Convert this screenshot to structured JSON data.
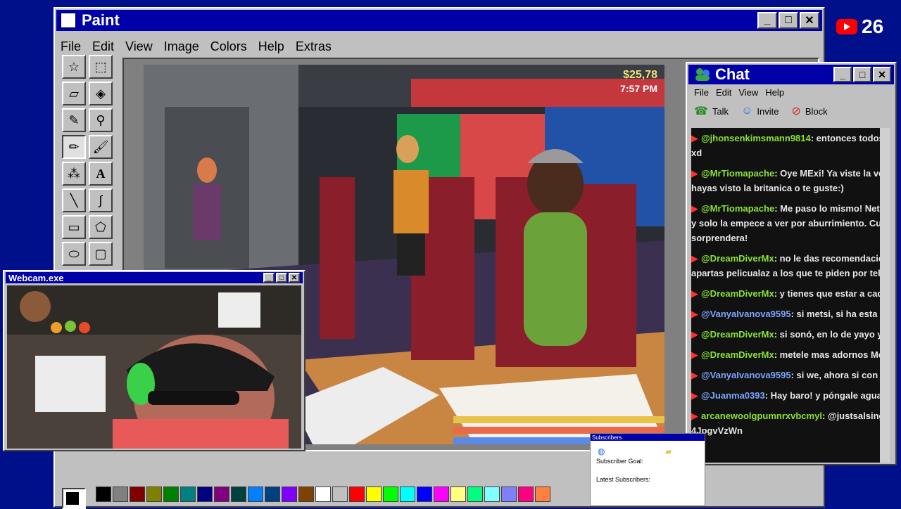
{
  "paint": {
    "title": "Paint",
    "menu": [
      "File",
      "Edit",
      "View",
      "Image",
      "Colors",
      "Help",
      "Extras"
    ],
    "tools": [
      "free-select",
      "rect-select",
      "eraser",
      "fill",
      "picker",
      "magnifier",
      "pencil",
      "brush",
      "airbrush",
      "text",
      "line",
      "curve",
      "rectangle",
      "polygon",
      "ellipse",
      "rounded-rect"
    ],
    "palette": [
      "#000000",
      "#808080",
      "#800000",
      "#808000",
      "#008000",
      "#008080",
      "#000080",
      "#800080",
      "#004040",
      "#0080ff",
      "#004080",
      "#8000ff",
      "#804000",
      "#ffffff",
      "#c0c0c0",
      "#ff0000",
      "#ffff00",
      "#00ff00",
      "#00ffff",
      "#0000ff",
      "#ff00ff",
      "#ffff80",
      "#00ff80",
      "#80ffff",
      "#8080ff",
      "#ff0080",
      "#ff8040"
    ]
  },
  "game": {
    "money": "$25,78",
    "time": "7:57 PM"
  },
  "youtube": {
    "count": "26"
  },
  "chat": {
    "title": "Chat",
    "menu": [
      "File",
      "Edit",
      "View",
      "Help"
    ],
    "toolbar": [
      "Talk",
      "Invite",
      "Block"
    ],
    "messages": [
      {
        "user": "@jhonsenkimsmann9814",
        "text": ": entonces todos s",
        "cont": "xd",
        "color": "green"
      },
      {
        "user": "@MrTiomapache",
        "text": ": Oye MExi! Ya viste la vers",
        "cont": "hayas visto la britanica o te guste:)",
        "color": "green"
      },
      {
        "user": "@MrTiomapache",
        "text": ": Me paso lo mismo! Neta",
        "cont": "y solo la empece a ver por aburrimiento. Cuando",
        "cont2": "sorprendera!",
        "color": "green"
      },
      {
        "user": "@DreamDiverMx",
        "text": ": no le das recomendacion",
        "cont": "apartas pelicualaz a los que te piden por telefon",
        "color": "green"
      },
      {
        "user": "@DreamDiverMx",
        "text": ": y tienes que estar a cada",
        "color": "green"
      },
      {
        "user": "@VanyaIvanova9595",
        "text": ": si metsi, si ha esta",
        "color": "blue"
      },
      {
        "user": "@DreamDiverMx",
        "text": ": si sonó, en lo de yayo y e",
        "color": "green"
      },
      {
        "user": "@DreamDiverMx",
        "text": ": metele mas adornos Mets",
        "color": "green"
      },
      {
        "user": "@VanyaIvanova9595",
        "text": ": si we, ahora si con",
        "color": "blue"
      },
      {
        "user": "@Juanma0393",
        "text": ": Hay baro! y póngale agua",
        "color": "blue"
      },
      {
        "user": "arcanewoolgpumnrxvbcmyl",
        "text": ": @justsalsing",
        "cont": "4JpgvVzWn",
        "color": "green"
      }
    ]
  },
  "webcam": {
    "title": "Webcam.exe"
  },
  "subscribers": {
    "title": "Subscribers",
    "goal_label": "Subscriber Goal:",
    "latest_label": "Latest Subscribers:"
  }
}
